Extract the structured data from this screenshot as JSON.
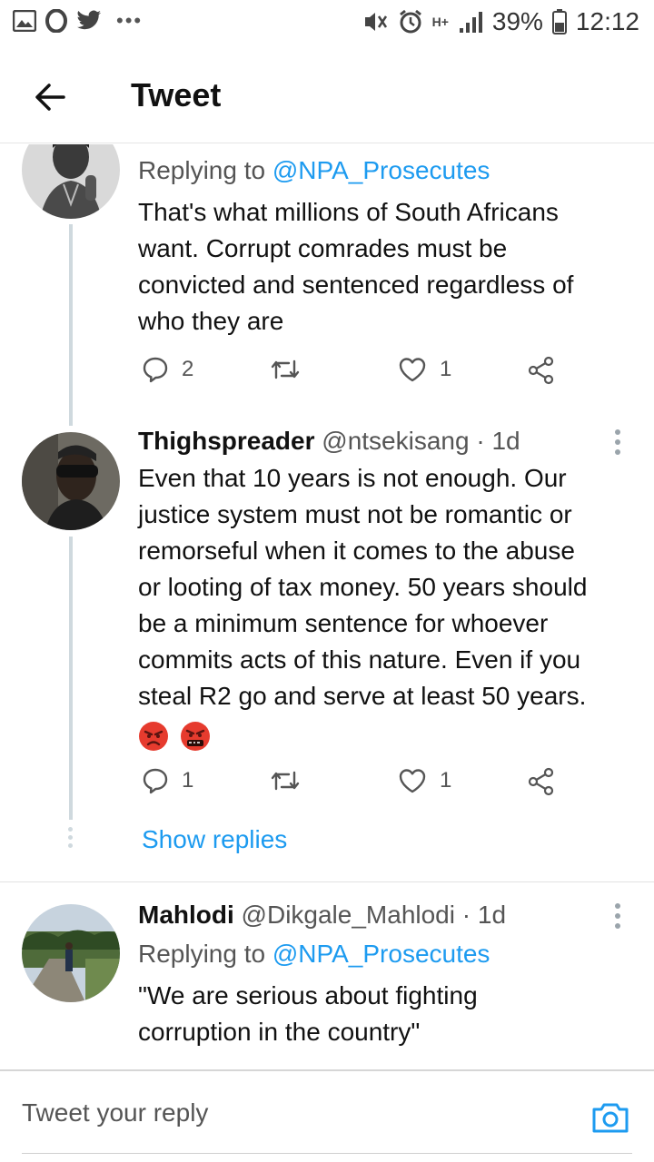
{
  "status_bar": {
    "battery": "39%",
    "time": "12:12",
    "network": "H+"
  },
  "header": {
    "title": "Tweet"
  },
  "tweets": [
    {
      "replying_label": "Replying to",
      "replying_to": "@NPA_Prosecutes",
      "text_lines": [
        "That's what millions of South Africans",
        "want. Corrupt comrades must be",
        "convicted and sentenced regardless of",
        "who they are"
      ],
      "replies": "2",
      "likes": "1"
    },
    {
      "name": "Thighspreader",
      "handle": "@ntsekisang",
      "time": "· 1d",
      "text_lines": [
        "Even that 10 years is not enough. Our",
        "justice system must not be romantic or",
        "remorseful when it comes to the abuse",
        "or looting of tax money. 50 years should",
        "be a minimum sentence for whoever",
        "commits acts of this nature. Even if you",
        "steal R2 go and serve at least 50 years."
      ],
      "emojis": [
        "angry-face",
        "face-with-symbols-on-mouth"
      ],
      "replies": "1",
      "likes": "1",
      "show_replies": "Show replies"
    },
    {
      "name": "Mahlodi",
      "handle": "@Dikgale_Mahlodi",
      "time": "· 1d",
      "replying_label": "Replying to",
      "replying_to": "@NPA_Prosecutes",
      "text_lines": [
        "\"We are serious about fighting",
        "corruption in the country\""
      ]
    }
  ],
  "reply_bar": {
    "placeholder": "Tweet your reply"
  },
  "colors": {
    "accent": "#1d9bf0",
    "secondary_text": "#555555",
    "thread_line": "#cfd9de"
  }
}
